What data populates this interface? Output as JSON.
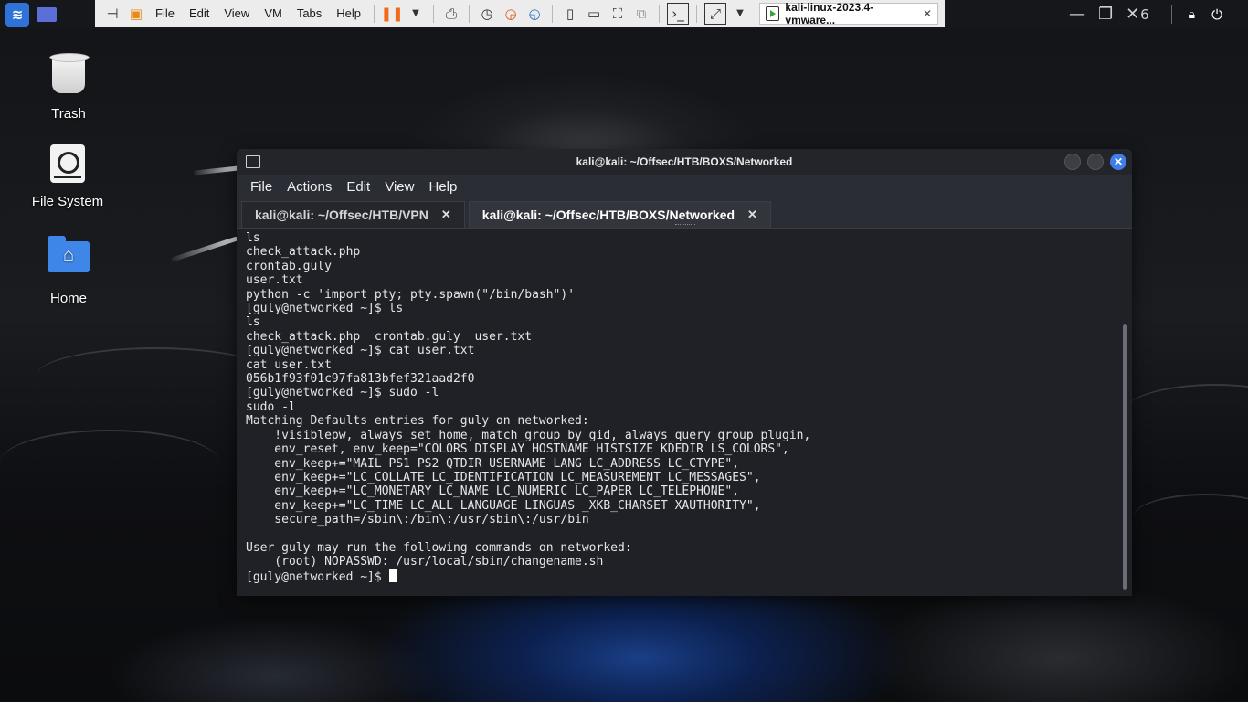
{
  "vm_menu": {
    "items": [
      "File",
      "Edit",
      "View",
      "VM",
      "Tabs",
      "Help"
    ],
    "tab_title": "kali-linux-2023.4-vmware..."
  },
  "top_panel": {
    "partial_text": "6"
  },
  "desktop": {
    "icons": [
      {
        "label": "Trash"
      },
      {
        "label": "File System"
      },
      {
        "label": "Home"
      }
    ]
  },
  "terminal": {
    "title": "kali@kali: ~/Offsec/HTB/BOXS/Networked",
    "menu": [
      "File",
      "Actions",
      "Edit",
      "View",
      "Help"
    ],
    "tabs": [
      {
        "label": "kali@kali: ~/Offsec/HTB/VPN"
      },
      {
        "label": "kali@kali: ~/Offsec/HTB/BOXS/Networked"
      }
    ],
    "output": "ls\ncheck_attack.php\ncrontab.guly\nuser.txt\npython -c 'import pty; pty.spawn(\"/bin/bash\")'\n[guly@networked ~]$ ls\nls\ncheck_attack.php  crontab.guly  user.txt\n[guly@networked ~]$ cat user.txt\ncat user.txt\n056b1f93f01c97fa813bfef321aad2f0\n[guly@networked ~]$ sudo -l\nsudo -l\nMatching Defaults entries for guly on networked:\n    !visiblepw, always_set_home, match_group_by_gid, always_query_group_plugin,\n    env_reset, env_keep=\"COLORS DISPLAY HOSTNAME HISTSIZE KDEDIR LS_COLORS\",\n    env_keep+=\"MAIL PS1 PS2 QTDIR USERNAME LANG LC_ADDRESS LC_CTYPE\",\n    env_keep+=\"LC_COLLATE LC_IDENTIFICATION LC_MEASUREMENT LC_MESSAGES\",\n    env_keep+=\"LC_MONETARY LC_NAME LC_NUMERIC LC_PAPER LC_TELEPHONE\",\n    env_keep+=\"LC_TIME LC_ALL LANGUAGE LINGUAS _XKB_CHARSET XAUTHORITY\",\n    secure_path=/sbin\\:/bin\\:/usr/sbin\\:/usr/bin\n\nUser guly may run the following commands on networked:\n    (root) NOPASSWD: /usr/local/sbin/changename.sh",
    "prompt": "[guly@networked ~]$ "
  }
}
